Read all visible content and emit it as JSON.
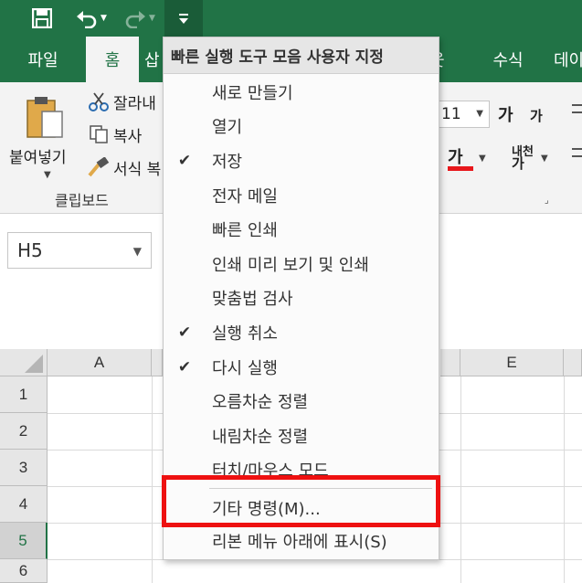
{
  "qat": {
    "save_icon": "save-icon",
    "undo_icon": "undo-icon",
    "redo_icon": "redo-icon",
    "customize_icon": "customize-qat-icon"
  },
  "tabs": {
    "file": "파일",
    "home": "홈",
    "insert_partial": "삽",
    "review_partial": "웃",
    "formulas": "수식",
    "data_partial": "데이"
  },
  "clipboard": {
    "paste": "붙여넣기",
    "cut": "잘라내",
    "copy": "복사",
    "format_painter": "서식 복",
    "group_label": "클립보드"
  },
  "font": {
    "size": "11",
    "grow": "가",
    "shrink": "가",
    "color_glyph": "가",
    "phonetic_top": "내천",
    "phonetic_bottom": "가"
  },
  "namebox": {
    "value": "H5"
  },
  "grid": {
    "columns": [
      "A",
      "E"
    ],
    "rows": [
      "1",
      "2",
      "3",
      "4",
      "5",
      "6"
    ],
    "active_row": "5"
  },
  "menu": {
    "header": "빠른 실행 도구 모음 사용자 지정",
    "items": [
      {
        "label": "새로 만들기",
        "checked": false
      },
      {
        "label": "열기",
        "checked": false
      },
      {
        "label": "저장",
        "checked": true
      },
      {
        "label": "전자 메일",
        "checked": false
      },
      {
        "label": "빠른 인쇄",
        "checked": false
      },
      {
        "label": "인쇄 미리 보기 및 인쇄",
        "checked": false
      },
      {
        "label": "맞춤법 검사",
        "checked": false
      },
      {
        "label": "실행 취소",
        "checked": true
      },
      {
        "label": "다시 실행",
        "checked": true
      },
      {
        "label": "오름차순 정렬",
        "checked": false
      },
      {
        "label": "내림차순 정렬",
        "checked": false
      },
      {
        "label": "터치/마우스 모드",
        "checked": false
      },
      {
        "label": "기타 명령(M)...",
        "checked": false
      },
      {
        "label": "리본 메뉴 아래에 표시(S)",
        "checked": false
      }
    ],
    "check_glyph": "✔"
  },
  "colors": {
    "excel_green": "#217346",
    "highlight_red": "#ee1111",
    "font_color_red": "#e8171b"
  }
}
